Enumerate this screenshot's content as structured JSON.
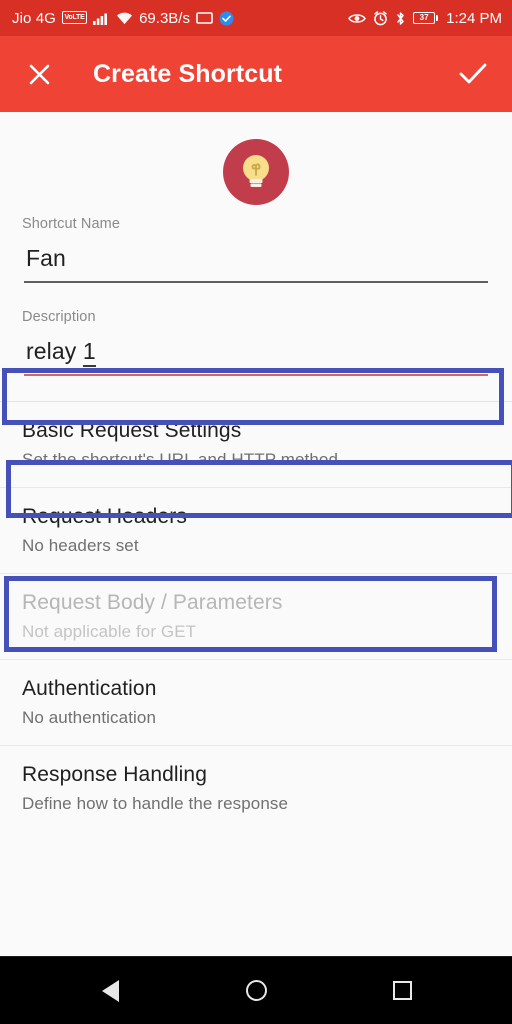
{
  "status_bar": {
    "carrier": "Jio 4G",
    "volte_badge": "VoLTE",
    "network_speed": "69.3B/s",
    "battery_level": "37",
    "time": "1:24 PM",
    "icons": [
      "signal-bars-icon",
      "wifi-icon",
      "screencast-icon",
      "sync-badge-icon",
      "eye-icon",
      "alarm-clock-icon",
      "bluetooth-icon",
      "battery-icon"
    ],
    "background_color": "#d93025"
  },
  "app_bar": {
    "title": "Create Shortcut",
    "close_icon": "close-x-icon",
    "confirm_icon": "checkmark-icon",
    "background_color": "#ef4435"
  },
  "shortcut_icon": {
    "name": "light-bulb-icon",
    "circle_color": "#c13d4b",
    "glyph_color": "#f8dd8a"
  },
  "form": {
    "name_field": {
      "label": "Shortcut Name",
      "value": "Fan",
      "underline_color": "#5f5f5f"
    },
    "description_field": {
      "label": "Description",
      "value_text": "relay ",
      "value_composing": "1",
      "underline_color": "#d0695c"
    }
  },
  "list": {
    "items": [
      {
        "title": "Basic Request Settings",
        "subtitle": "Set the shortcut's URL and HTTP method",
        "disabled": false
      },
      {
        "title": "Request Headers",
        "subtitle": "No headers set",
        "disabled": false
      },
      {
        "title": "Request Body / Parameters",
        "subtitle": "Not applicable for GET",
        "disabled": true
      },
      {
        "title": "Authentication",
        "subtitle": "No authentication",
        "disabled": false
      },
      {
        "title": "Response Handling",
        "subtitle": "Define how to handle the response",
        "disabled": false
      }
    ]
  },
  "annotations": {
    "highlight_color": "#4550b8",
    "boxes": [
      "shortcut-name-field",
      "description-field",
      "basic-request-settings-item"
    ]
  },
  "nav_bar": {
    "back_icon": "back-triangle-icon",
    "home_icon": "home-circle-icon",
    "recents_icon": "recents-square-icon",
    "background_color": "#000000"
  }
}
